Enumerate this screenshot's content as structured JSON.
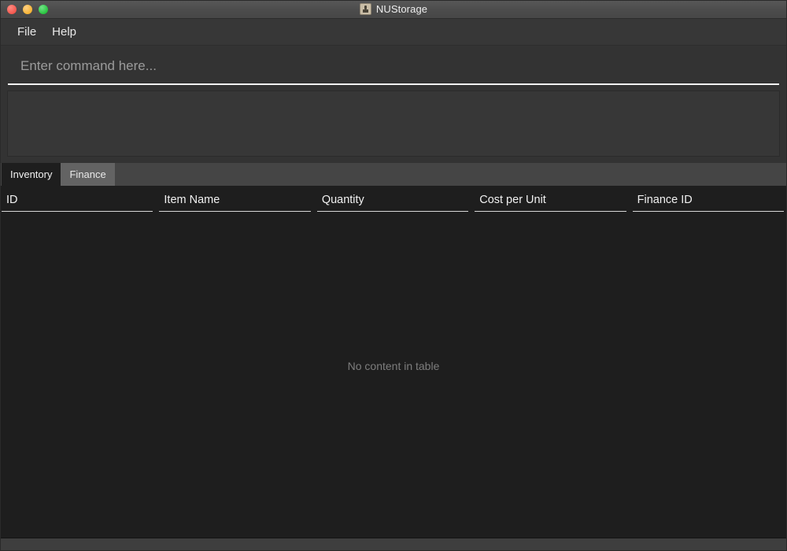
{
  "window": {
    "title": "NUStorage",
    "icon": "app-box-icon",
    "traffic_lights": {
      "close_label": "Close",
      "minimize_label": "Minimize",
      "maximize_label": "Maximize",
      "close_color": "#f4584f",
      "minimize_color": "#f8b435",
      "maximize_color": "#29c53f"
    }
  },
  "menubar": {
    "items": [
      {
        "label": "File"
      },
      {
        "label": "Help"
      }
    ]
  },
  "command": {
    "placeholder": "Enter command here...",
    "value": ""
  },
  "result": {
    "text": ""
  },
  "tabs": [
    {
      "label": "Inventory",
      "selected": true
    },
    {
      "label": "Finance",
      "selected": false
    }
  ],
  "table": {
    "columns": [
      {
        "label": "ID"
      },
      {
        "label": "Item Name"
      },
      {
        "label": "Quantity"
      },
      {
        "label": "Cost per Unit"
      },
      {
        "label": "Finance ID"
      }
    ],
    "rows": [],
    "empty_text": "No content in table"
  },
  "theme": {
    "titlebar_bg": "#4c4c4c",
    "menubar_bg": "#373737",
    "panel_bg": "#333333",
    "tabbar_bg": "#454545",
    "tab_unselected_bg": "#636363",
    "content_bg": "#1e1e1e",
    "footer_bg": "#3e3e3e",
    "header_underline": "#d7d7d7",
    "placeholder_text": "#7d7d7d"
  }
}
